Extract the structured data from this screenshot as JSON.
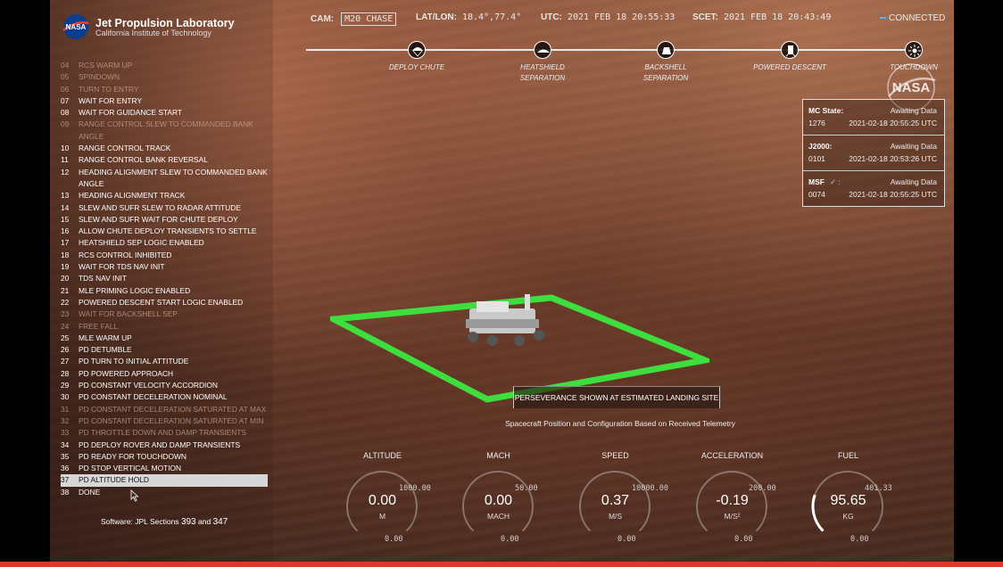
{
  "header": {
    "org_title": "Jet Propulsion Laboratory",
    "org_subtitle": "California Institute of Technology",
    "logo_text": "NASA",
    "cam_label": "CAM:",
    "cam_value": "M20 CHASE",
    "latlon_label": "LAT/LON:",
    "latlon_value": "18.4°,77.4°",
    "utc_label": "UTC:",
    "utc_value": "2021 FEB 18 20:55:33",
    "scet_label": "SCET:",
    "scet_value": "2021 FEB 18 20:43:49",
    "connection": "CONNECTED"
  },
  "timeline": [
    {
      "label": "DEPLOY CHUTE",
      "icon": "parachute-icon"
    },
    {
      "label": "HEATSHIELD SEPARATION",
      "icon": "heatshield-icon"
    },
    {
      "label": "BACKSHELL SEPARATION",
      "icon": "backshell-icon"
    },
    {
      "label": "POWERED DESCENT",
      "icon": "descent-stage-icon"
    },
    {
      "label": "TOUCHDOWN",
      "icon": "touchdown-icon"
    }
  ],
  "steps": [
    {
      "num": "04",
      "label": "RCS WARM UP",
      "dim": true
    },
    {
      "num": "05",
      "label": "SPINDOWN",
      "dim": true
    },
    {
      "num": "06",
      "label": "TURN TO ENTRY",
      "dim": true
    },
    {
      "num": "07",
      "label": "WAIT FOR ENTRY",
      "dim": false
    },
    {
      "num": "08",
      "label": "WAIT FOR GUIDANCE START",
      "dim": false
    },
    {
      "num": "09",
      "label": "RANGE CONTROL SLEW TO COMMANDED BANK ANGLE",
      "dim": true
    },
    {
      "num": "10",
      "label": "RANGE CONTROL TRACK",
      "dim": false
    },
    {
      "num": "11",
      "label": "RANGE CONTROL BANK REVERSAL",
      "dim": false
    },
    {
      "num": "12",
      "label": "HEADING ALIGNMENT SLEW TO COMMANDED BANK ANGLE",
      "dim": false
    },
    {
      "num": "13",
      "label": "HEADING ALIGNMENT TRACK",
      "dim": false
    },
    {
      "num": "14",
      "label": "SLEW AND SUFR SLEW TO RADAR ATTITUDE",
      "dim": false
    },
    {
      "num": "15",
      "label": "SLEW AND SUFR WAIT FOR CHUTE DEPLOY",
      "dim": false
    },
    {
      "num": "16",
      "label": "ALLOW CHUTE DEPLOY TRANSIENTS TO SETTLE",
      "dim": false
    },
    {
      "num": "17",
      "label": "HEATSHIELD SEP LOGIC ENABLED",
      "dim": false
    },
    {
      "num": "18",
      "label": "RCS CONTROL INHIBITED",
      "dim": false
    },
    {
      "num": "19",
      "label": "WAIT FOR TDS NAV INIT",
      "dim": false
    },
    {
      "num": "20",
      "label": "TDS NAV INIT",
      "dim": false
    },
    {
      "num": "21",
      "label": "MLE PRIMING LOGIC ENABLED",
      "dim": false
    },
    {
      "num": "22",
      "label": "POWERED DESCENT START LOGIC ENABLED",
      "dim": false
    },
    {
      "num": "23",
      "label": "WAIT FOR BACKSHELL SEP",
      "dim": true
    },
    {
      "num": "24",
      "label": "FREE FALL",
      "dim": true
    },
    {
      "num": "25",
      "label": "MLE WARM UP",
      "dim": false
    },
    {
      "num": "26",
      "label": "PD DETUMBLE",
      "dim": false
    },
    {
      "num": "27",
      "label": "PD TURN TO INITIAL ATTITUDE",
      "dim": false
    },
    {
      "num": "28",
      "label": "PD POWERED APPROACH",
      "dim": false
    },
    {
      "num": "29",
      "label": "PD CONSTANT VELOCITY ACCORDION",
      "dim": false
    },
    {
      "num": "30",
      "label": "PD CONSTANT DECELERATION NOMINAL",
      "dim": false
    },
    {
      "num": "31",
      "label": "PD CONSTANT DECELERATION SATURATED AT MAX",
      "dim": true
    },
    {
      "num": "32",
      "label": "PD CONSTANT DECELERATION SATURATED AT MIN",
      "dim": true
    },
    {
      "num": "33",
      "label": "PD THROTTLE DOWN AND DAMP TRANSIENTS",
      "dim": true
    },
    {
      "num": "34",
      "label": "PD DEPLOY ROVER AND DAMP TRANSIENTS",
      "dim": false
    },
    {
      "num": "35",
      "label": "PD READY FOR TOUCHDOWN",
      "dim": false
    },
    {
      "num": "36",
      "label": "PD STOP VERTICAL MOTION",
      "dim": false
    },
    {
      "num": "37",
      "label": "PD ALTITUDE HOLD",
      "dim": false,
      "active": true
    },
    {
      "num": "38",
      "label": "DONE",
      "dim": false
    }
  ],
  "software": {
    "prefix": "Software: JPL Sections",
    "section_a": "393",
    "joiner": "and",
    "section_b": "347"
  },
  "state_panel": [
    {
      "name": "MC State:",
      "status": "Awaiting Data",
      "number": "1276",
      "time": "2021-02-18 20:55:25 UTC"
    },
    {
      "name": "J2000:",
      "status": "Awaiting Data",
      "number": "0101",
      "time": "2021-02-18 20:53:26 UTC"
    },
    {
      "name": "MSF",
      "suffix": "✓ :",
      "status": "Awaiting Data",
      "number": "0074",
      "time": "2021-02-18 20:55:25 UTC"
    }
  ],
  "seal_text": "NASA",
  "scene": {
    "caption": "PERSEVERANCE SHOWN AT ESTIMATED LANDING SITE",
    "sub_caption": "Spacecraft Position and Configuration Based on Received Telemetry"
  },
  "gauges": [
    {
      "title": "ALTITUDE",
      "value": "0.00",
      "unit": "M",
      "max": "1000.00",
      "min": "0.00",
      "fill": 0
    },
    {
      "title": "MACH",
      "value": "0.00",
      "unit": "MACH",
      "max": "50.00",
      "min": "0.00",
      "fill": 0
    },
    {
      "title": "SPEED",
      "value": "0.37",
      "unit": "M/S",
      "max": "10000.00",
      "min": "0.00",
      "fill": 0
    },
    {
      "title": "ACCELERATION",
      "value": "-0.19",
      "unit": "M/S²",
      "max": "200.00",
      "min": "0.00",
      "fill": 0
    },
    {
      "title": "FUEL",
      "value": "95.65",
      "unit": "KG",
      "max": "401.33",
      "min": "0.00",
      "fill": 0.2383
    }
  ],
  "colors": {
    "accent_green": "#3dde3d",
    "alert_red": "#d93a2b",
    "connected_blue": "#5ab0ff"
  }
}
